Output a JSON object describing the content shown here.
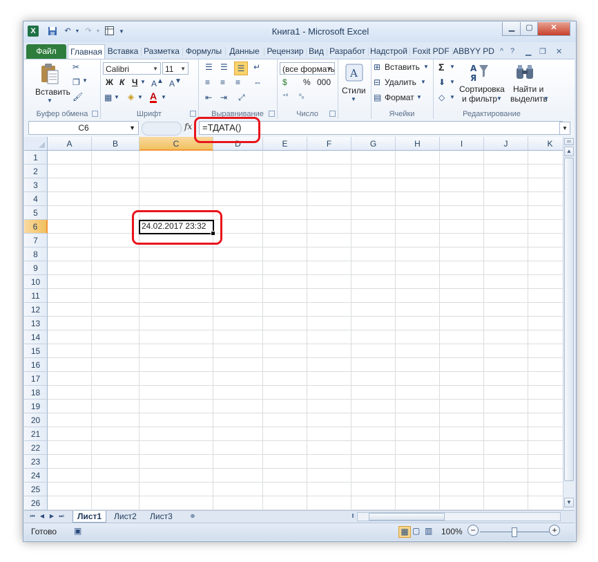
{
  "window": {
    "title": "Книга1 - Microsoft Excel",
    "app_logo": "X"
  },
  "quick_access": {
    "save_icon": "save-icon",
    "undo_icon": "undo-icon",
    "redo_icon": "redo-icon"
  },
  "tabs": [
    {
      "label": "Файл"
    },
    {
      "label": "Главная"
    },
    {
      "label": "Вставка"
    },
    {
      "label": "Разметка"
    },
    {
      "label": "Формулы"
    },
    {
      "label": "Данные"
    },
    {
      "label": "Рецензир"
    },
    {
      "label": "Вид"
    },
    {
      "label": "Разработ"
    },
    {
      "label": "Надстрой"
    },
    {
      "label": "Foxit PDF"
    },
    {
      "label": "ABBYY PD"
    }
  ],
  "ribbon": {
    "clipboard": {
      "label": "Буфер обмена",
      "paste": "Вставить"
    },
    "font": {
      "label": "Шрифт",
      "font_name": "Calibri",
      "font_size": "11",
      "bold": "Ж",
      "italic": "К",
      "underline": "Ч",
      "font_color_glyph": "A"
    },
    "alignment": {
      "label": "Выравнивание"
    },
    "number": {
      "label": "Число",
      "format": "(все форматы)",
      "percent": "%",
      "thousands": "000"
    },
    "styles": {
      "label": "Стили"
    },
    "cells": {
      "label": "Ячейки",
      "insert": "Вставить",
      "delete": "Удалить",
      "format": "Формат"
    },
    "editing": {
      "label": "Редактирование",
      "sort_line1": "Сортировка",
      "sort_line2": "и фильтр",
      "find_line1": "Найти и",
      "find_line2": "выделить",
      "sum_glyph": "Σ"
    }
  },
  "formula_bar": {
    "name_box": "C6",
    "fx": "fx",
    "formula": "=ТДАТА()"
  },
  "columns": [
    "A",
    "B",
    "C",
    "D",
    "E",
    "F",
    "G",
    "H",
    "I",
    "J",
    "K"
  ],
  "rows": [
    "1",
    "2",
    "3",
    "4",
    "5",
    "6",
    "7",
    "8",
    "9",
    "10",
    "11",
    "12",
    "13",
    "14",
    "15",
    "16",
    "17",
    "18",
    "19",
    "20",
    "21",
    "22",
    "23",
    "24",
    "25",
    "26"
  ],
  "selected": {
    "column": "C",
    "row": "6",
    "value": "24.02.2017 23:32"
  },
  "sheets": [
    {
      "label": "Лист1",
      "active": true
    },
    {
      "label": "Лист2",
      "active": false
    },
    {
      "label": "Лист3",
      "active": false
    }
  ],
  "status": {
    "ready": "Готово",
    "zoom": "100%",
    "zoom_minus": "−",
    "zoom_plus": "+"
  },
  "colors": {
    "highlight": "#e8141b",
    "file_tab": "#2f7d3c",
    "selection_header": "#f1c15f"
  }
}
